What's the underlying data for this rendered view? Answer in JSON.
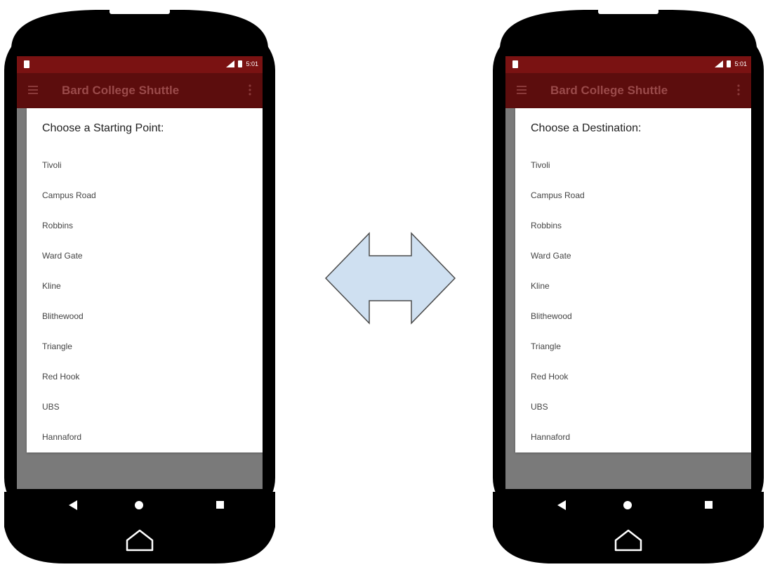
{
  "phones": [
    {
      "status": {
        "time": "5:01"
      },
      "appbar": {
        "title": "Bard College Shuttle"
      },
      "dialog": {
        "title": "Choose a Starting Point:",
        "items": [
          "Tivoli",
          "Campus Road",
          "Robbins",
          "Ward Gate",
          "Kline",
          "Blithewood",
          "Triangle",
          "Red Hook",
          "UBS",
          "Hannaford"
        ]
      }
    },
    {
      "status": {
        "time": "5:01"
      },
      "appbar": {
        "title": "Bard College Shuttle"
      },
      "dialog": {
        "title": "Choose a Destination:",
        "items": [
          "Tivoli",
          "Campus Road",
          "Robbins",
          "Ward Gate",
          "Kline",
          "Blithewood",
          "Triangle",
          "Red Hook",
          "UBS",
          "Hannaford"
        ]
      }
    }
  ],
  "colors": {
    "statusbar": "#7a1212",
    "appbar": "#5c0d0d",
    "arrow_fill": "#cfe0f1",
    "phone_body": "#000000"
  }
}
